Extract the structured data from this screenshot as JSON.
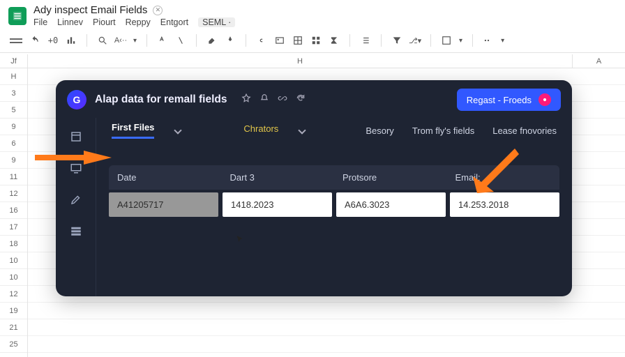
{
  "doc": {
    "title": "Ady inspect Email Fields"
  },
  "menu": {
    "file": "File",
    "linnev": "Linnev",
    "piourt": "Piourt",
    "reppy": "Reppy",
    "entgort": "Entgort",
    "seml": "SEML ·"
  },
  "cols": {
    "jf": "Jf",
    "h": "H",
    "a": "A"
  },
  "rows": [
    "H",
    "3",
    "5",
    "9",
    "6",
    "9",
    "11",
    "12",
    "16",
    "17",
    "18",
    "10",
    "10",
    "12",
    "19",
    "21",
    "25"
  ],
  "overlay": {
    "logo": "G",
    "title": "Alap data for remall fields",
    "button": "Regast - Froeds",
    "tabs": {
      "first": "First Files",
      "chrators": "Chrators",
      "besory": "Besory",
      "trom": "Trom fly's fields",
      "lease": "Lease fnovories"
    },
    "table": {
      "headers": {
        "date": "Date",
        "dart": "Dart 3",
        "protsore": "Protsore",
        "email": "Email:"
      },
      "row": {
        "c0": "A41205717",
        "c1": "1418.2023",
        "c2": "A6A6.3023",
        "c3": "14.253.2018"
      }
    }
  }
}
